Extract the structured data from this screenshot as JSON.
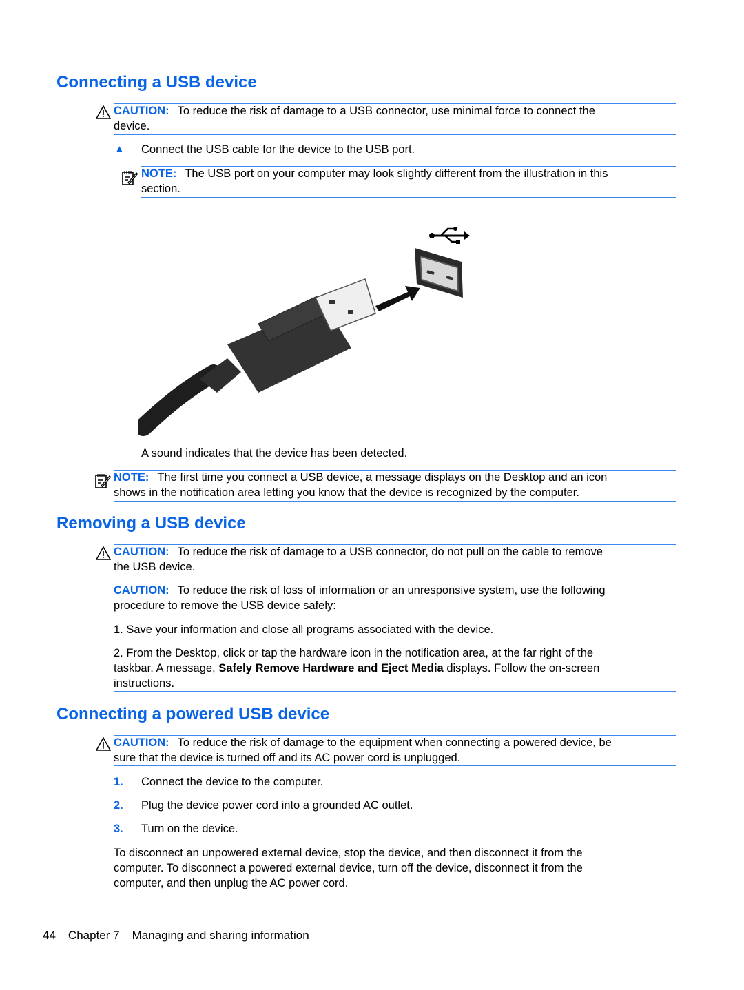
{
  "section1": {
    "heading": "Connecting a USB device",
    "caution": {
      "label": "CAUTION:",
      "line1": "To reduce the risk of damage to a USB connector, use minimal force to connect the",
      "line2": "device."
    },
    "step": "Connect the USB cable for the device to the USB port.",
    "note1": {
      "label": "NOTE:",
      "line1": "The USB port on your computer may look slightly different from the illustration in this",
      "line2": "section."
    },
    "illustration": "usb-cable-into-usb-port",
    "after_text": "A sound indicates that the device has been detected.",
    "note2": {
      "label": "NOTE:",
      "line1": "The first time you connect a USB device, a message displays on the Desktop and an icon",
      "line2": "shows in the notification area letting you know that the device is recognized by the computer."
    }
  },
  "section2": {
    "heading": "Removing a USB device",
    "caution1": {
      "label": "CAUTION:",
      "line1": "To reduce the risk of damage to a USB connector, do not pull on the cable to remove",
      "line2": "the USB device."
    },
    "caution2": {
      "label": "CAUTION:",
      "line1": "To reduce the risk of loss of information or an unresponsive system, use the following",
      "line2": "procedure to remove the USB device safely:"
    },
    "step1": "1. Save your information and close all programs associated with the device.",
    "step2": {
      "line1": "2. From the Desktop, click or tap the hardware icon in the notification area, at the far right of the",
      "line2_pre": "taskbar. A message, ",
      "line2_bold": "Safely Remove Hardware and Eject Media",
      "line2_post": " displays. Follow the on-screen",
      "line3": "instructions."
    }
  },
  "section3": {
    "heading": "Connecting a powered USB device",
    "caution": {
      "label": "CAUTION:",
      "line1": "To reduce the risk of damage to the equipment when connecting a powered device, be",
      "line2": "sure that the device is turned off and its AC power cord is unplugged."
    },
    "steps": [
      {
        "num": "1.",
        "text": "Connect the device to the computer."
      },
      {
        "num": "2.",
        "text": "Plug the device power cord into a grounded AC outlet."
      },
      {
        "num": "3.",
        "text": "Turn on the device."
      }
    ],
    "paragraph": [
      "To disconnect an unpowered external device, stop the device, and then disconnect it from the",
      "computer. To disconnect a powered external device, turn off the device, disconnect it from the",
      "computer, and then unplug the AC power cord."
    ]
  },
  "footer": {
    "page": "44",
    "chapter": "Chapter 7",
    "title": "Managing and sharing information"
  },
  "colors": {
    "accent": "#0a64e6",
    "rule": "#3a87ef"
  }
}
